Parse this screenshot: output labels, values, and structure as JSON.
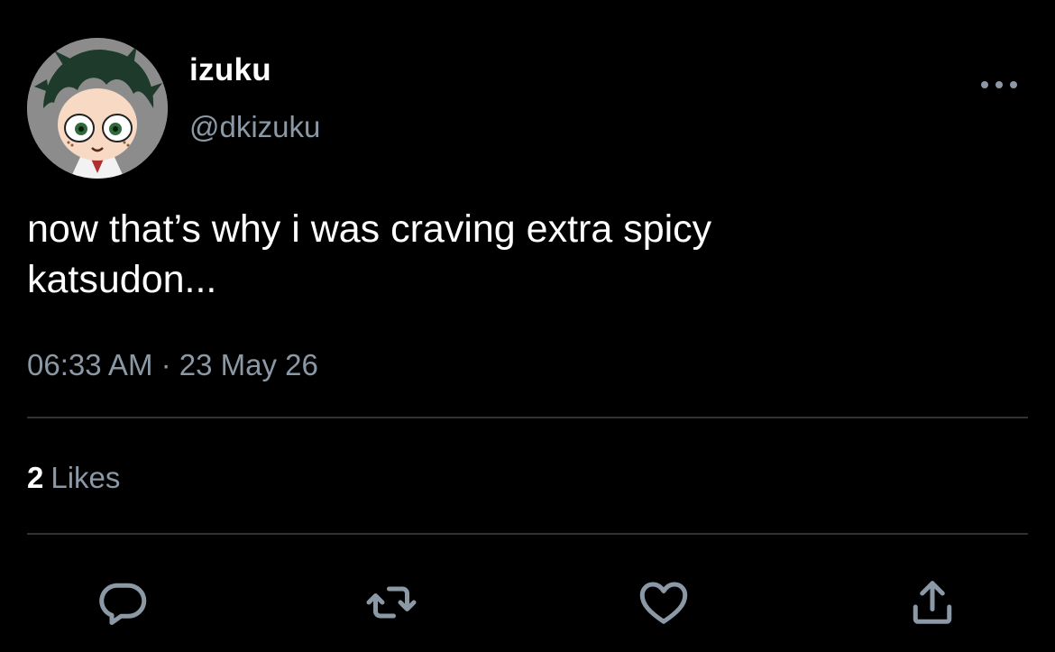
{
  "author": {
    "display_name": "izuku",
    "handle": "@dkizuku",
    "avatar_icon": "avatar-image"
  },
  "tweet": {
    "text": "now that’s why i was craving extra spicy\nkatsudon...",
    "time": "06:33 AM",
    "separator": " · ",
    "date": "23 May 26"
  },
  "stats": {
    "likes_count": "2",
    "likes_label": "Likes"
  },
  "actions": [
    {
      "name": "reply",
      "icon": "speech-bubble-icon"
    },
    {
      "name": "retweet",
      "icon": "retweet-arrows-icon"
    },
    {
      "name": "like",
      "icon": "heart-icon"
    },
    {
      "name": "share",
      "icon": "share-upload-icon"
    }
  ],
  "colors": {
    "background": "#000000",
    "primary_text": "#ffffff",
    "secondary_text": "#8b98a5",
    "divider": "#2f3336"
  }
}
